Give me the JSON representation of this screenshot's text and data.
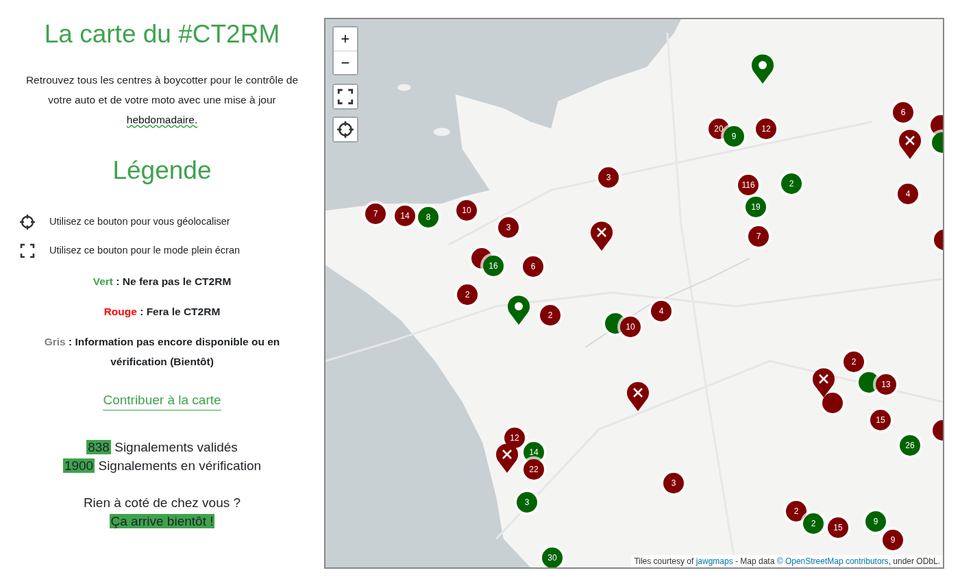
{
  "sidebar": {
    "title": "La carte du #CT2RM",
    "intro": "Retrouvez tous les centres à boycotter pour le contrôle de votre auto et de votre moto avec une mise à jour",
    "intro_link": "hebdomadaire.",
    "legend_title": "Légende",
    "controls_help": [
      {
        "kind": "locate",
        "text": "Utilisez ce bouton pour vous géolocaliser"
      },
      {
        "kind": "fullscreen",
        "text": "Utilisez ce bouton pour le mode plein écran"
      }
    ],
    "colors": [
      {
        "label": "Vert",
        "color": "#3fa34d",
        "text": " : Ne fera pas le CT2RM"
      },
      {
        "label": "Rouge",
        "color": "#ff0000",
        "text": " : Fera le CT2RM"
      },
      {
        "label": "Gris",
        "color": "#808080",
        "text": " : Information pas encore disponible ou en vérification (Bientôt)"
      }
    ],
    "contribute_link": "Contribuer à la carte",
    "stats": [
      {
        "count": "838",
        "text": "Signalements validés"
      },
      {
        "count": "1900",
        "text": "Signalements en vérification"
      }
    ],
    "nearby_question": "Rien à coté de chez vous ?",
    "nearby_answer": "Ça arrive bientôt !"
  },
  "map": {
    "controls": [
      {
        "kind": "zoom_in",
        "label": "+"
      },
      {
        "kind": "zoom_out",
        "label": "−"
      },
      {
        "kind": "fullscreen"
      },
      {
        "kind": "locate"
      }
    ],
    "markers": [
      {
        "kind": "cluster",
        "color": "#800000",
        "count": "7"
      },
      {
        "kind": "cluster",
        "color": "#800000",
        "count": "14"
      },
      {
        "kind": "cluster",
        "color": "#006400",
        "count": "8"
      },
      {
        "kind": "cluster",
        "color": "#800000",
        "count": "10"
      },
      {
        "kind": "cluster",
        "color": "#800000",
        "count": "3"
      },
      {
        "kind": "cluster",
        "color": "#800000",
        "count": "3"
      },
      {
        "kind": "cluster",
        "color": "#800000"
      },
      {
        "kind": "cluster",
        "color": "#006400",
        "count": "16"
      },
      {
        "kind": "cluster",
        "color": "#800000",
        "count": "6"
      },
      {
        "kind": "cluster",
        "color": "#800000",
        "count": "2"
      },
      {
        "kind": "cluster",
        "color": "#800000",
        "count": "2"
      },
      {
        "kind": "cluster",
        "color": "#006400"
      },
      {
        "kind": "cluster",
        "color": "#800000",
        "count": "10"
      },
      {
        "kind": "cluster",
        "color": "#800000",
        "count": "4"
      },
      {
        "kind": "cluster",
        "color": "#800000",
        "count": "20"
      },
      {
        "kind": "cluster",
        "color": "#006400",
        "count": "9"
      },
      {
        "kind": "cluster",
        "color": "#800000",
        "count": "12"
      },
      {
        "kind": "cluster",
        "color": "#800000",
        "count": "116"
      },
      {
        "kind": "cluster",
        "color": "#006400",
        "count": "2"
      },
      {
        "kind": "cluster",
        "color": "#006400",
        "count": "19"
      },
      {
        "kind": "cluster",
        "color": "#800000",
        "count": "7"
      },
      {
        "kind": "cluster",
        "color": "#800000",
        "count": "6"
      },
      {
        "kind": "cluster",
        "color": "#800000",
        "count": "4"
      },
      {
        "kind": "cluster",
        "color": "#800000"
      },
      {
        "kind": "cluster",
        "color": "#006400"
      },
      {
        "kind": "cluster",
        "color": "#800000"
      },
      {
        "kind": "cluster",
        "color": "#800000",
        "count": "2"
      },
      {
        "kind": "cluster",
        "color": "#006400"
      },
      {
        "kind": "cluster",
        "color": "#800000",
        "count": "13"
      },
      {
        "kind": "cluster",
        "color": "#800000"
      },
      {
        "kind": "cluster",
        "color": "#800000",
        "count": "15"
      },
      {
        "kind": "cluster",
        "color": "#800000"
      },
      {
        "kind": "cluster",
        "color": "#006400",
        "count": "26"
      },
      {
        "kind": "cluster",
        "color": "#800000",
        "count": "12"
      },
      {
        "kind": "cluster",
        "color": "#006400",
        "count": "14"
      },
      {
        "kind": "cluster",
        "color": "#800000",
        "count": "22"
      },
      {
        "kind": "cluster",
        "color": "#006400",
        "count": "3"
      },
      {
        "kind": "cluster",
        "color": "#800000",
        "count": "3"
      },
      {
        "kind": "cluster",
        "color": "#800000",
        "count": "2"
      },
      {
        "kind": "cluster",
        "color": "#006400",
        "count": "2"
      },
      {
        "kind": "cluster",
        "color": "#800000",
        "count": "15"
      },
      {
        "kind": "cluster",
        "color": "#006400",
        "count": "9"
      },
      {
        "kind": "cluster",
        "color": "#800000",
        "count": "9"
      },
      {
        "kind": "cluster",
        "color": "#006400",
        "count": "30"
      },
      {
        "kind": "pin",
        "color": "#006400"
      },
      {
        "kind": "pin",
        "color": "#006400"
      },
      {
        "kind": "cross",
        "color": "#800000"
      },
      {
        "kind": "cross",
        "color": "#800000"
      },
      {
        "kind": "cross",
        "color": "#800000"
      },
      {
        "kind": "cross",
        "color": "#800000"
      },
      {
        "kind": "cross",
        "color": "#800000"
      }
    ],
    "attribution": {
      "prefix": "Tiles courtesy of ",
      "tiles_link": "jawgmaps",
      "middle": " - Map data ",
      "data_link": "© OpenStreetMap contributors",
      "suffix": ", under ODbL."
    }
  }
}
